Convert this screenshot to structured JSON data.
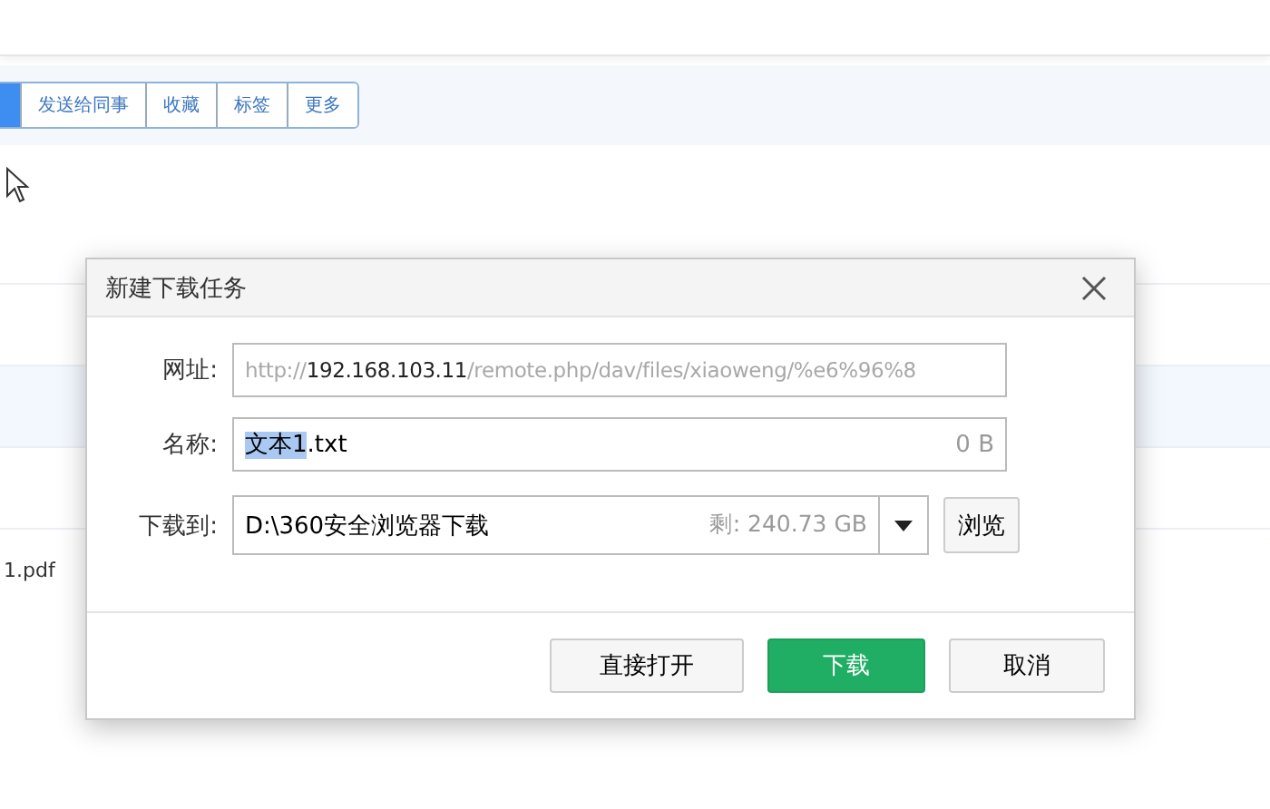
{
  "toolbar": {
    "buttons": [
      {
        "selected": true
      },
      {
        "label": "发送给同事",
        "selected": false
      },
      {
        "label": "收藏",
        "selected": false
      },
      {
        "label": "标签",
        "selected": false
      },
      {
        "label": "更多",
        "selected": false
      }
    ]
  },
  "rows": [
    {
      "highlighted": false
    },
    {
      "highlighted": true
    },
    {
      "highlighted": false
    },
    {
      "name": "1.pdf",
      "highlighted": false
    }
  ],
  "dialog": {
    "title": "新建下载任务",
    "url_label": "网址:",
    "url": {
      "scheme": "http://",
      "host": "192.168.103.11",
      "path": "/remote.php/dav/files/xiaoweng/%e6%96%8"
    },
    "name_label": "名称:",
    "name": {
      "selected_part": "文本1",
      "rest": ".txt"
    },
    "size": "0 B",
    "dest_label": "下载到:",
    "dest": "D:\\360安全浏览器下载",
    "free": "剩: 240.73 GB",
    "browse": "浏览",
    "buttons": [
      {
        "label": "直接打开",
        "kind": "secondary"
      },
      {
        "label": "下载",
        "kind": "primary"
      },
      {
        "label": "取消",
        "kind": "secondary"
      }
    ]
  }
}
